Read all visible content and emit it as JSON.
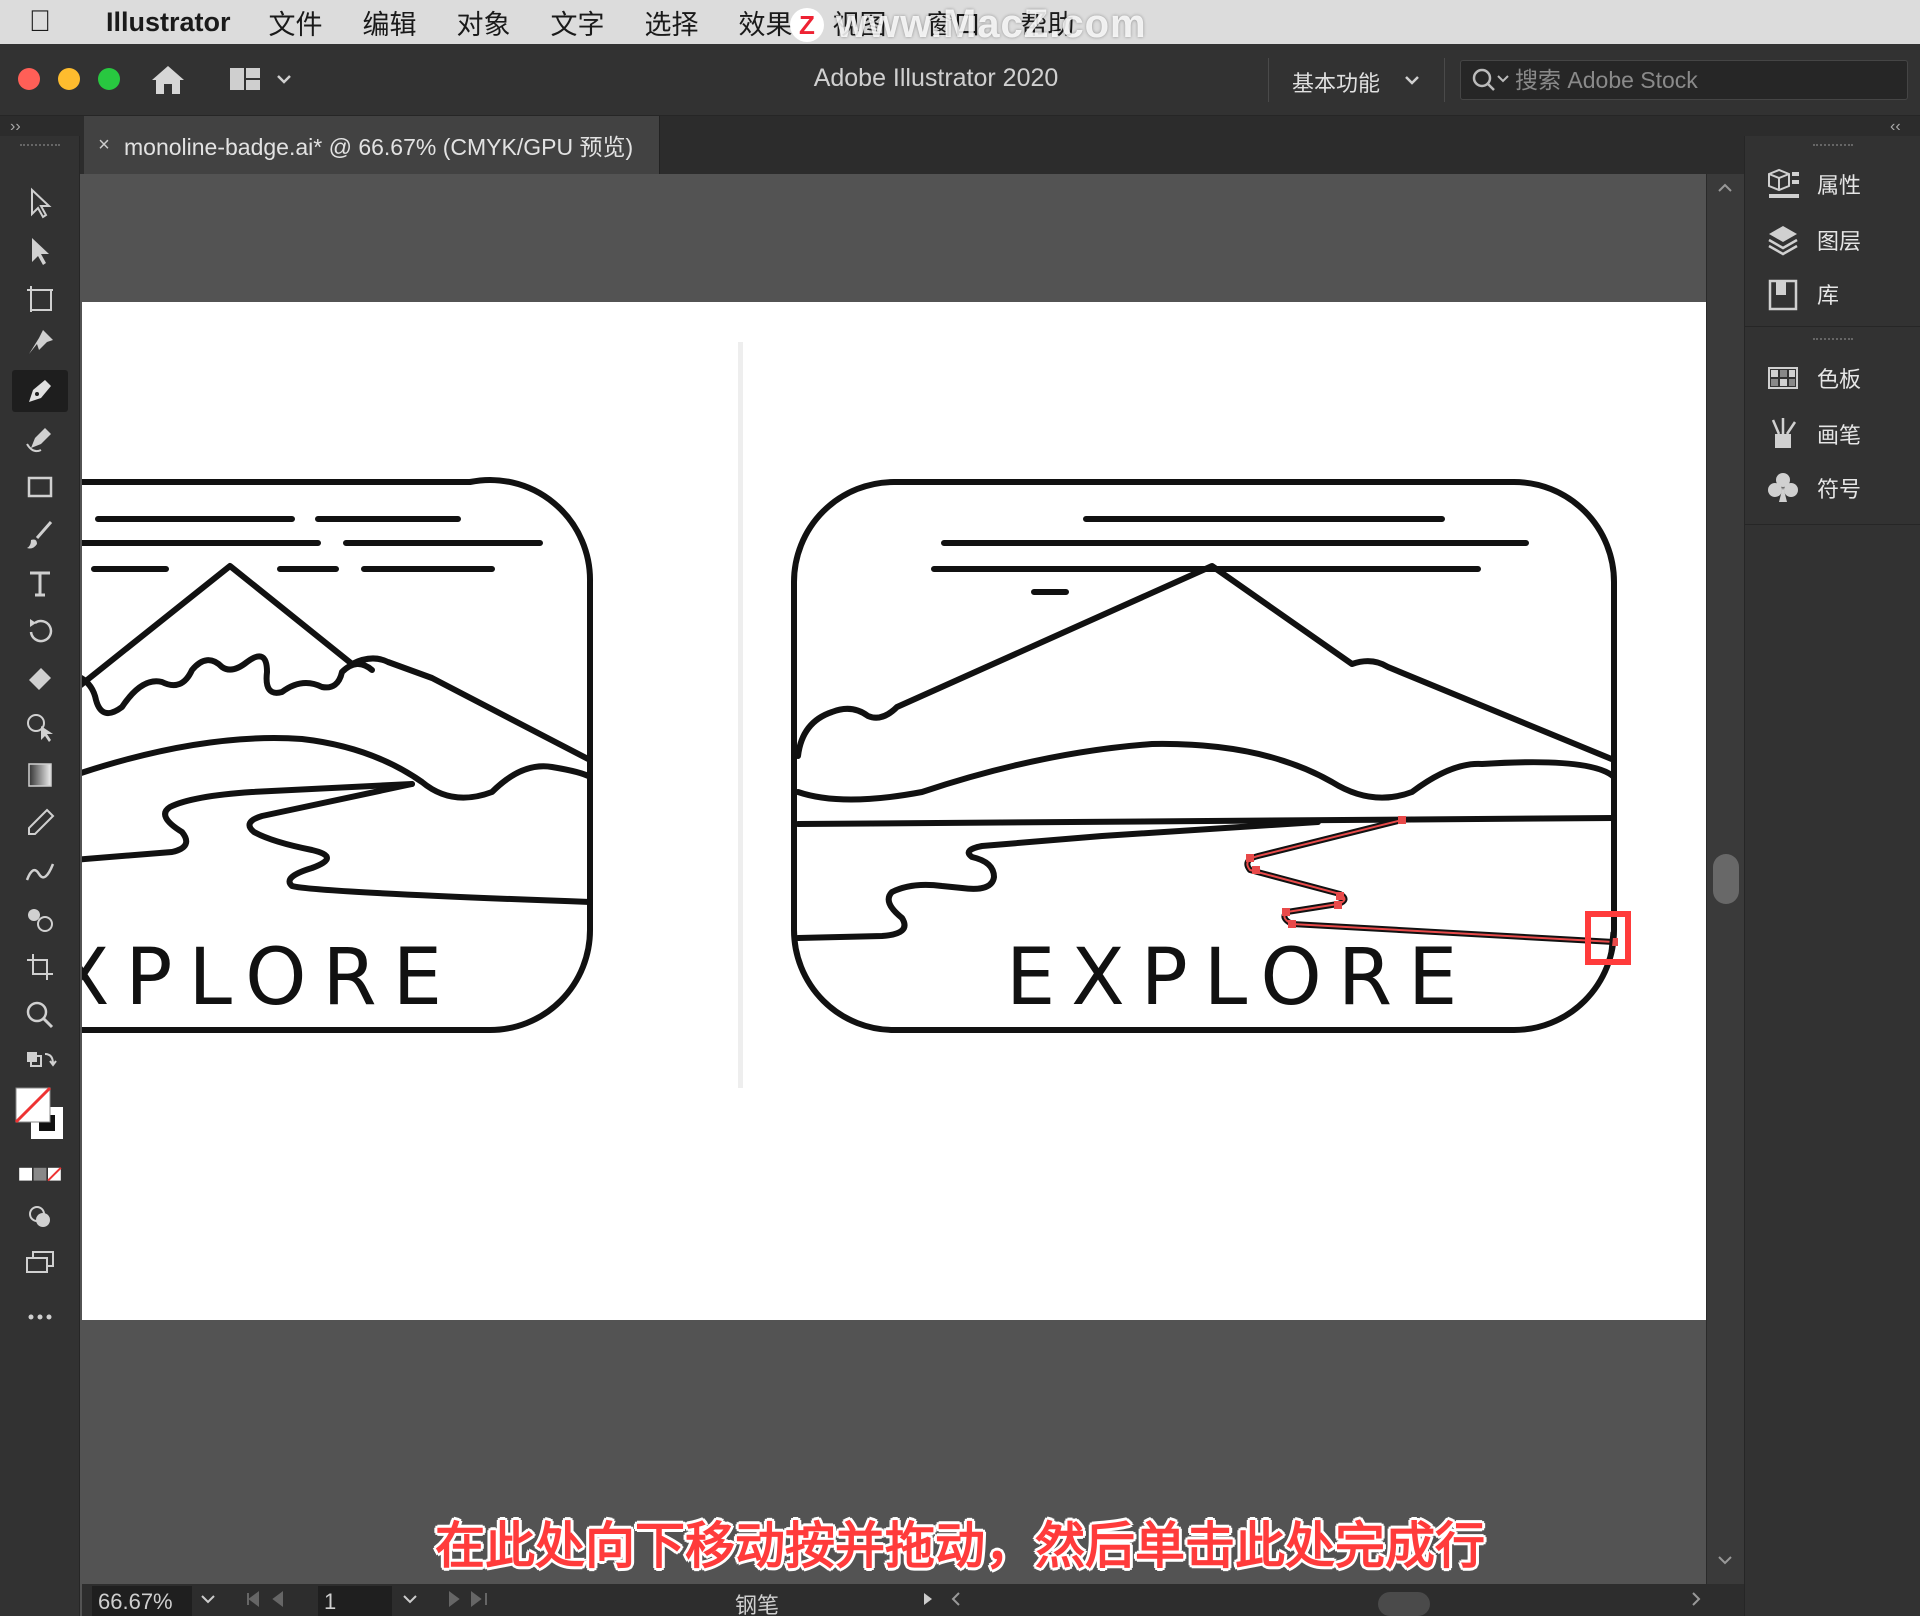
{
  "menubar": {
    "app_name": "Illustrator",
    "items": [
      "文件",
      "编辑",
      "对象",
      "文字",
      "选择",
      "效果",
      "视图",
      "窗口",
      "帮助"
    ],
    "watermark": "www.MacZ.com",
    "watermark_badge": "Z"
  },
  "appbar": {
    "title": "Adobe Illustrator 2020",
    "workspace": "基本功能",
    "search_placeholder": "搜索 Adobe Stock"
  },
  "tabrow": {
    "collapse_left": "››",
    "collapse_right": "‹‹"
  },
  "document_tab": {
    "close": "×",
    "name": "monoline-badge.ai* @ 66.67% (CMYK/GPU 预览)"
  },
  "artwork": {
    "badge_left_text": "XPLORE",
    "badge_right_text": "EXPLORE"
  },
  "statusbar": {
    "zoom": "66.67%",
    "artboard": "1",
    "tool": "钢笔"
  },
  "right_panel": {
    "items": [
      "属性",
      "图层",
      "库",
      "色板",
      "画笔",
      "符号"
    ]
  },
  "subtitle": "在此处向下移动按并拖动，然后单击此处完成行",
  "colors": {
    "accent_red": "#ff3b3b",
    "anchor_red": "#e84a4a",
    "traffic_red": "#ff5f57",
    "traffic_yellow": "#febc2e",
    "traffic_green": "#28c840"
  }
}
